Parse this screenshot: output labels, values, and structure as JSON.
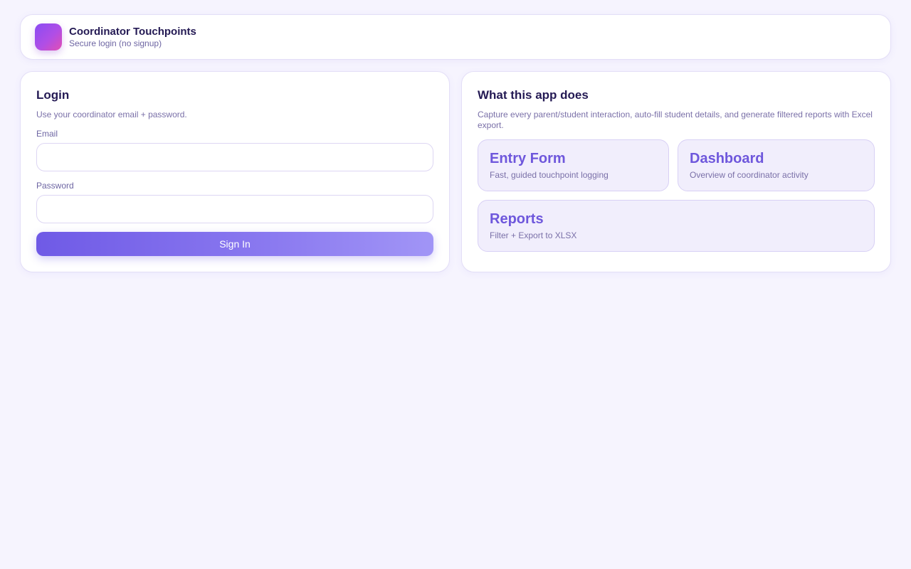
{
  "header": {
    "logo_icon": "app-logo-gradient",
    "title": "Coordinator Touchpoints",
    "subtitle": "Secure login (no signup)"
  },
  "login": {
    "title": "Login",
    "description": "Use your coordinator email + password.",
    "email_label": "Email",
    "email_value": "",
    "password_label": "Password",
    "password_value": "",
    "submit_label": "Sign In"
  },
  "about": {
    "title": "What this app does",
    "description": "Capture every parent/student interaction, auto-fill student details, and generate filtered reports with Excel export.",
    "features": [
      {
        "title": "Entry Form",
        "subtitle": "Fast, guided touchpoint logging"
      },
      {
        "title": "Dashboard",
        "subtitle": "Overview of coordinator activity"
      },
      {
        "title": "Reports",
        "subtitle": "Filter + Export to XLSX"
      }
    ]
  },
  "colors": {
    "background": "#f6f4fe",
    "accent": "#6f5ae6",
    "feature_title": "#6e57dc",
    "logo_gradient": [
      "#8a4cf3",
      "#e24fb3"
    ]
  }
}
